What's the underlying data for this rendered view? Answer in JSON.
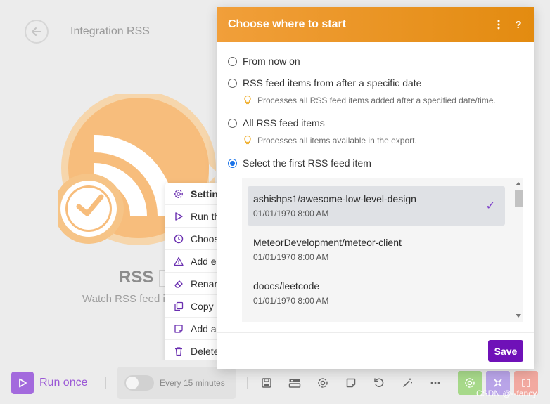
{
  "page": {
    "title": "Integration RSS"
  },
  "module": {
    "name": "RSS",
    "subtitle": "Watch RSS feed it"
  },
  "context_menu": {
    "items": [
      {
        "label": "Settin",
        "icon": "gear-icon"
      },
      {
        "label": "Run th",
        "icon": "play-icon"
      },
      {
        "label": "Choos",
        "icon": "clock-icon"
      },
      {
        "label": "Add e",
        "icon": "warning-icon"
      },
      {
        "label": "Renan",
        "icon": "eraser-icon"
      },
      {
        "label": "Copy",
        "icon": "copy-icon"
      },
      {
        "label": "Add a",
        "icon": "note-icon"
      },
      {
        "label": "Delete",
        "icon": "trash-icon"
      }
    ]
  },
  "toolbar": {
    "run_label": "Run once",
    "schedule_label": "Every 15 minutes",
    "colors": {
      "run": "#8b3fd9",
      "green": "#a7d98a",
      "purple": "#b9a4e8",
      "red": "#f2a9a0"
    }
  },
  "watermark": "CSDN @--fancy",
  "dialog": {
    "title": "Choose where to start",
    "options": [
      {
        "label": "From now on",
        "checked": false
      },
      {
        "label": "RSS feed items from after a specific date",
        "checked": false,
        "hint": "Processes all RSS feed items added after a specified date/time."
      },
      {
        "label": "All RSS feed items",
        "checked": false,
        "hint": "Processes all items available in the export."
      },
      {
        "label": "Select the first RSS feed item",
        "checked": true
      }
    ],
    "items": [
      {
        "title": "ashishps1/awesome-low-level-design",
        "date": "01/01/1970 8:00 AM",
        "selected": true
      },
      {
        "title": "MeteorDevelopment/meteor-client",
        "date": "01/01/1970 8:00 AM",
        "selected": false
      },
      {
        "title": "doocs/leetcode",
        "date": "01/01/1970 8:00 AM",
        "selected": false
      }
    ],
    "save_label": "Save",
    "check_mark": "✓",
    "colors": {
      "header": "#e8930f",
      "save": "#6f11b8"
    }
  }
}
